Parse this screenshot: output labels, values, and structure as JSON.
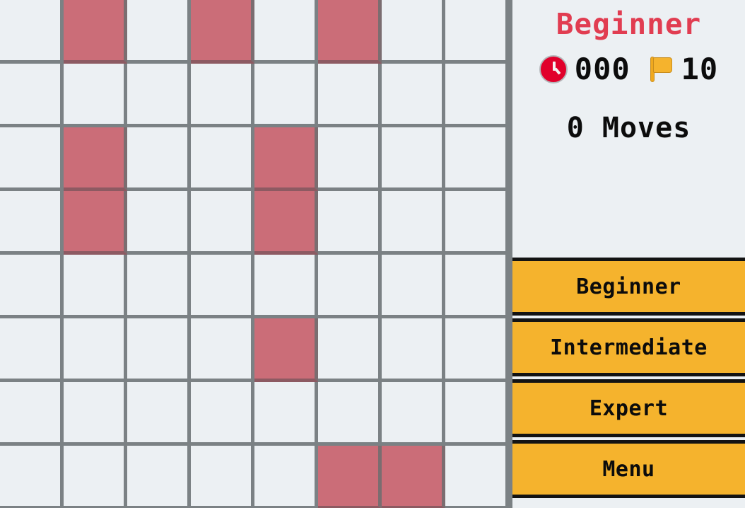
{
  "game": {
    "title": "Beginner",
    "title_color": "#e13d51",
    "timer_icon": "clock-icon",
    "timer_value": "000",
    "flag_icon": "flag-icon",
    "flag_value": "10",
    "moves_text": "0 Moves"
  },
  "board": {
    "columns": 8,
    "rows": 8,
    "cell_size": 90,
    "empty_color": "#ecf0f3",
    "mine_color": "#cb6d78",
    "border_color": "#7b8184",
    "cells": [
      [
        0,
        1,
        0,
        1,
        0,
        1,
        0,
        0
      ],
      [
        0,
        0,
        0,
        0,
        0,
        0,
        0,
        0
      ],
      [
        0,
        1,
        0,
        0,
        1,
        0,
        0,
        0
      ],
      [
        0,
        1,
        0,
        0,
        1,
        0,
        0,
        0
      ],
      [
        0,
        0,
        0,
        0,
        0,
        0,
        0,
        0
      ],
      [
        0,
        0,
        0,
        0,
        1,
        0,
        0,
        0
      ],
      [
        0,
        0,
        0,
        0,
        0,
        0,
        0,
        0
      ],
      [
        0,
        0,
        0,
        0,
        0,
        1,
        1,
        0
      ]
    ]
  },
  "buttons": [
    {
      "label": "Beginner",
      "name": "difficulty-beginner-button"
    },
    {
      "label": "Intermediate",
      "name": "difficulty-intermediate-button"
    },
    {
      "label": "Expert",
      "name": "difficulty-expert-button"
    },
    {
      "label": "Menu",
      "name": "menu-button"
    }
  ],
  "colors": {
    "button_fill": "#f5b32d",
    "button_border": "#131313",
    "panel_bg": "#ecf0f3"
  }
}
